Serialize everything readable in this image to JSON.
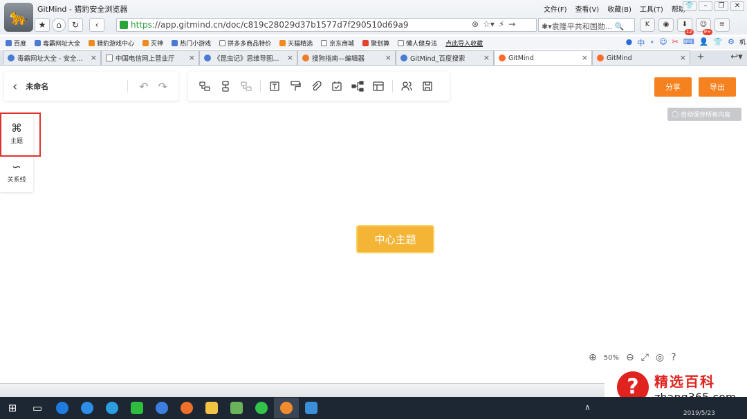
{
  "browser": {
    "title": "GitMind - 猎豹安全浏览器",
    "menu": [
      "文件(F)",
      "查看(V)",
      "收藏(B)",
      "工具(T)",
      "帮助"
    ],
    "url_https": "https",
    "url_rest": "://app.gitmind.cn/doc/c819c28029d37b1577d7f290510d69a9",
    "search_text": "✱▾袁隆平共和国勋...",
    "badge_1": "12",
    "badge_2": "9+",
    "bm_right_tail": "机"
  },
  "bookmarks": [
    {
      "label": "百度",
      "color": "b"
    },
    {
      "label": "毒霸网址大全",
      "color": "b"
    },
    {
      "label": "猎豹游戏中心",
      "color": "o"
    },
    {
      "label": "灭神",
      "color": "o"
    },
    {
      "label": "热门小游戏",
      "color": "b"
    },
    {
      "label": "拼多多商品特价",
      "color": "g"
    },
    {
      "label": "天猫精选",
      "color": "o"
    },
    {
      "label": "京东商城",
      "color": "g"
    },
    {
      "label": "聚划算",
      "color": "r"
    },
    {
      "label": "懒人健身法",
      "color": "g"
    },
    {
      "label": "点此导入收藏",
      "color": "none"
    }
  ],
  "tabs": [
    {
      "label": "毒霸网址大全 - 安全...",
      "icon": "b",
      "active": false
    },
    {
      "label": "中国电信网上营业厅",
      "icon": "p",
      "active": false
    },
    {
      "label": "《昆虫记》思维导图...",
      "icon": "b",
      "active": false
    },
    {
      "label": "搜狗指南—编辑器",
      "icon": "o",
      "active": false
    },
    {
      "label": "GitMind_百度搜索",
      "icon": "b",
      "active": false
    },
    {
      "label": "GitMind",
      "icon": "gm",
      "active": true
    },
    {
      "label": "GitMind",
      "icon": "gm",
      "active": false
    }
  ],
  "editor": {
    "doc_title": "未命名",
    "share_label": "分享",
    "export_label": "导出",
    "autosave": "自动保存所有内容",
    "center_topic": "中心主题",
    "zoom": "50%",
    "sidebar": {
      "theme_label": "主题",
      "relation_label": "关系线"
    }
  },
  "watermark": {
    "cn": "精选百科",
    "url": "zhang365.com"
  },
  "taskbar": {
    "date": "2019/5/23"
  }
}
